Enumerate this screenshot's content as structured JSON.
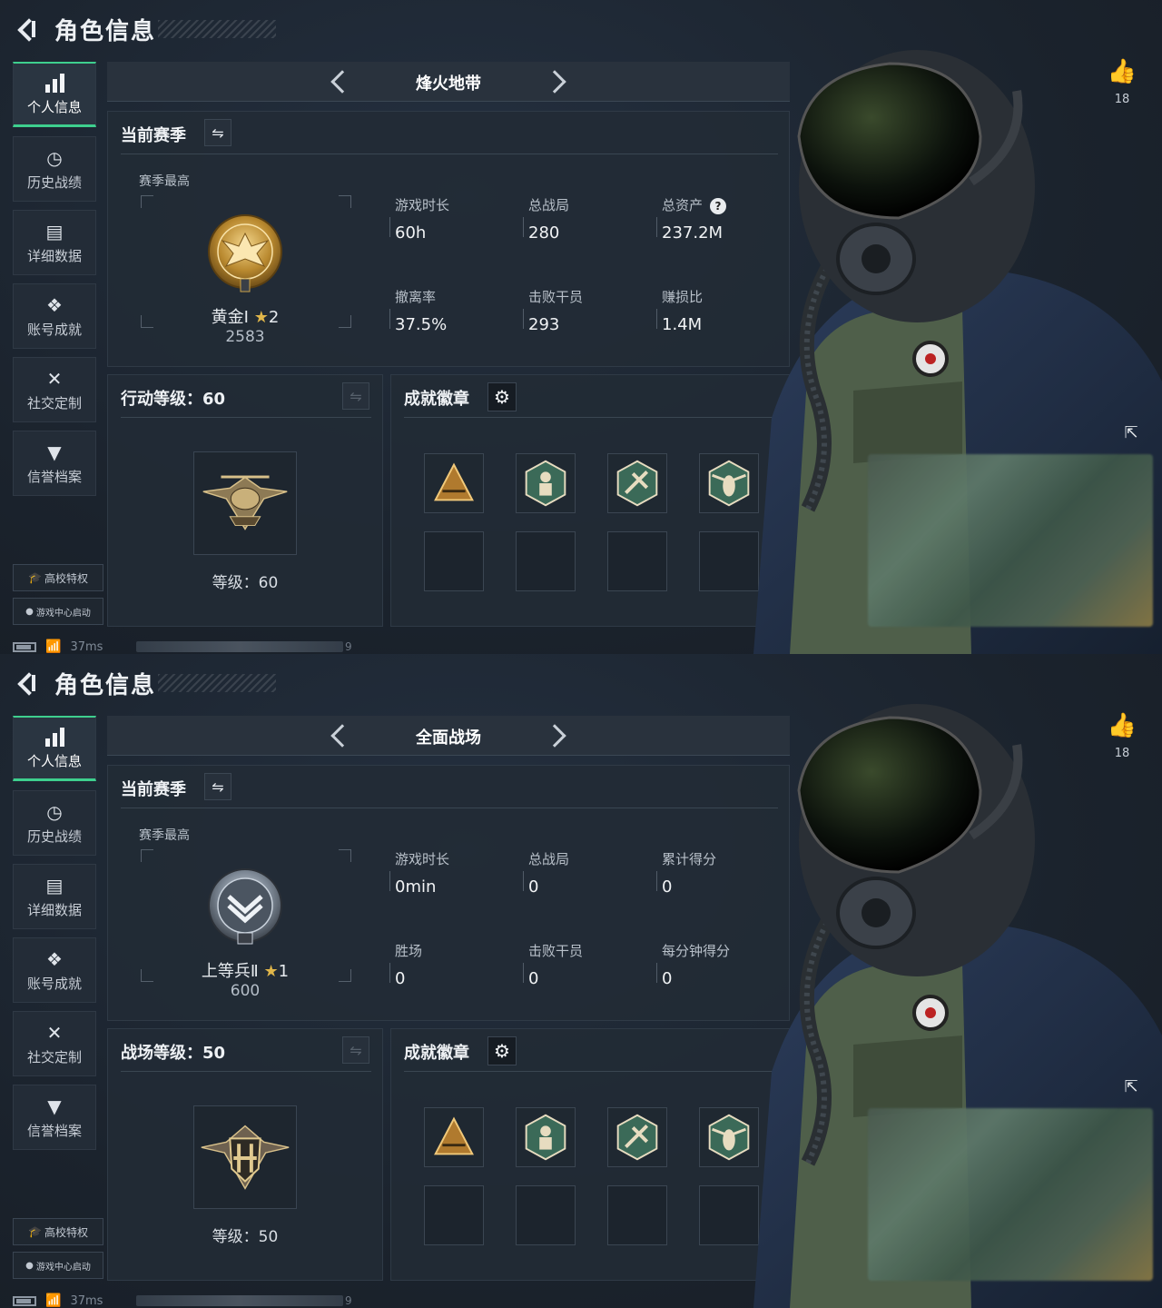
{
  "header": {
    "title": "角色信息"
  },
  "sidebar": {
    "items": [
      {
        "label": "个人信息",
        "icon": "bar-chart-icon"
      },
      {
        "label": "历史战绩",
        "icon": "history-clock-icon"
      },
      {
        "label": "详细数据",
        "icon": "data-folder-icon"
      },
      {
        "label": "账号成就",
        "icon": "achievement-icon"
      },
      {
        "label": "社交定制",
        "icon": "tools-icon"
      },
      {
        "label": "信誉档案",
        "icon": "reputation-icon"
      }
    ],
    "campus_btn": "高校特权",
    "launch_btn": "游戏中心启动"
  },
  "status": {
    "ping": "37ms",
    "trailing": "9"
  },
  "like_count": "18",
  "colors": {
    "accent": "#3ecf8e",
    "star": "#e0b64a",
    "panel": "#222b35"
  },
  "screens": [
    {
      "mode": "烽火地带",
      "season_title": "当前赛季",
      "season_best_label": "赛季最高",
      "rank_name": "黄金Ⅰ",
      "rank_stars": "2",
      "rank_score": "2583",
      "stats": [
        {
          "label": "游戏时长",
          "value": "60h"
        },
        {
          "label": "总战局",
          "value": "280"
        },
        {
          "label": "总资产",
          "value": "237.2M",
          "help": "?"
        },
        {
          "label": "撤离率",
          "value": "37.5%"
        },
        {
          "label": "击败干员",
          "value": "293"
        },
        {
          "label": "赚损比",
          "value": "1.4M"
        }
      ],
      "level_title": "行动等级：60",
      "level_label": "等级：60",
      "ach_title": "成就徽章"
    },
    {
      "mode": "全面战场",
      "season_title": "当前赛季",
      "season_best_label": "赛季最高",
      "rank_name": "上等兵Ⅱ",
      "rank_stars": "1",
      "rank_score": "600",
      "stats": [
        {
          "label": "游戏时长",
          "value": "0min"
        },
        {
          "label": "总战局",
          "value": "0"
        },
        {
          "label": "累计得分",
          "value": "0"
        },
        {
          "label": "胜场",
          "value": "0"
        },
        {
          "label": "击败干员",
          "value": "0"
        },
        {
          "label": "每分钟得分",
          "value": "0"
        }
      ],
      "level_title": "战场等级：50",
      "level_label": "等级：50",
      "ach_title": "成就徽章"
    }
  ]
}
